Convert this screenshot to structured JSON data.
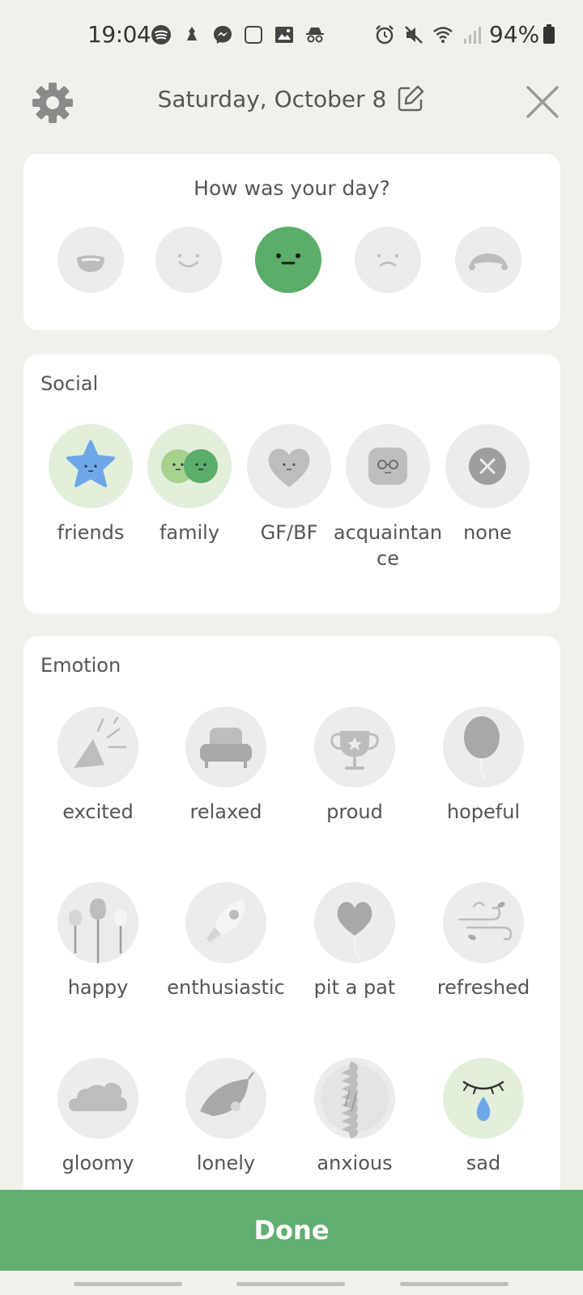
{
  "status_bar": {
    "time": "19:04",
    "battery": "94%"
  },
  "header": {
    "date": "Saturday, October 8"
  },
  "mood": {
    "question": "How was your day?",
    "options": [
      "very-happy",
      "happy",
      "neutral",
      "sad",
      "very-sad"
    ],
    "selected_index": 2,
    "selected_color": "#5bad6a"
  },
  "social": {
    "title": "Social",
    "items": [
      {
        "label": "friends",
        "icon": "star-icon",
        "selected": true
      },
      {
        "label": "family",
        "icon": "family-icon",
        "selected": true
      },
      {
        "label": "GF/BF",
        "icon": "heart-icon",
        "selected": false
      },
      {
        "label": "acquaintance",
        "icon": "glasses-icon",
        "selected": false
      },
      {
        "label": "none",
        "icon": "x-icon",
        "selected": false
      }
    ]
  },
  "emotion": {
    "title": "Emotion",
    "items": [
      {
        "label": "excited",
        "icon": "party-popper-icon",
        "selected": false
      },
      {
        "label": "relaxed",
        "icon": "armchair-icon",
        "selected": false
      },
      {
        "label": "proud",
        "icon": "trophy-icon",
        "selected": false
      },
      {
        "label": "hopeful",
        "icon": "balloon-icon",
        "selected": false
      },
      {
        "label": "happy",
        "icon": "tulips-icon",
        "selected": false
      },
      {
        "label": "enthusiastic",
        "icon": "rocket-icon",
        "selected": false
      },
      {
        "label": "pit a pat",
        "icon": "heart-balloon-icon",
        "selected": false
      },
      {
        "label": "refreshed",
        "icon": "wind-icon",
        "selected": false
      },
      {
        "label": "gloomy",
        "icon": "cloud-icon",
        "selected": false
      },
      {
        "label": "lonely",
        "icon": "leaf-icon",
        "selected": false
      },
      {
        "label": "anxious",
        "icon": "rope-icon",
        "selected": false
      },
      {
        "label": "sad",
        "icon": "teardrop-icon",
        "selected": true
      }
    ]
  },
  "done_label": "Done",
  "colors": {
    "accent": "#61ae6f",
    "background": "#f1f1ec",
    "selected_bg": "#e2efdb"
  }
}
